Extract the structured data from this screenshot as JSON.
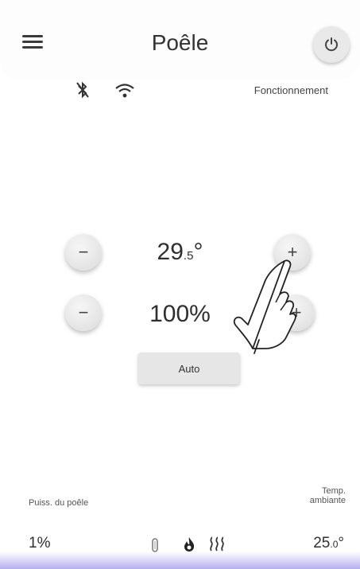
{
  "header": {
    "title": "Poêle",
    "menu_icon": "hamburger-menu-icon",
    "power_icon": "power-icon"
  },
  "status": {
    "bluetooth_icon": "bluetooth-off-icon",
    "wifi_icon": "wifi-icon",
    "label": "Fonctionnement"
  },
  "controls": {
    "temperature": {
      "integer": "29",
      "decimal": ".5",
      "unit": "°",
      "decrease_label": "−",
      "increase_label": "+"
    },
    "power": {
      "value": "100%",
      "decrease_label": "−",
      "increase_label": "+"
    },
    "auto_label": "Auto"
  },
  "footer": {
    "power_label": "Puiss. du poêle",
    "power_value": "1%",
    "temp_label_line1": "Temp.",
    "temp_label_line2": "ambiante",
    "temp_integer": "25",
    "temp_decimal": ".0",
    "temp_unit": "°",
    "icons": [
      "pellet-icon",
      "flame-icon",
      "heat-waves-icon"
    ]
  },
  "colors": {
    "accent_bottom": "#786ee1",
    "button_bg": "#e6e6e6"
  }
}
